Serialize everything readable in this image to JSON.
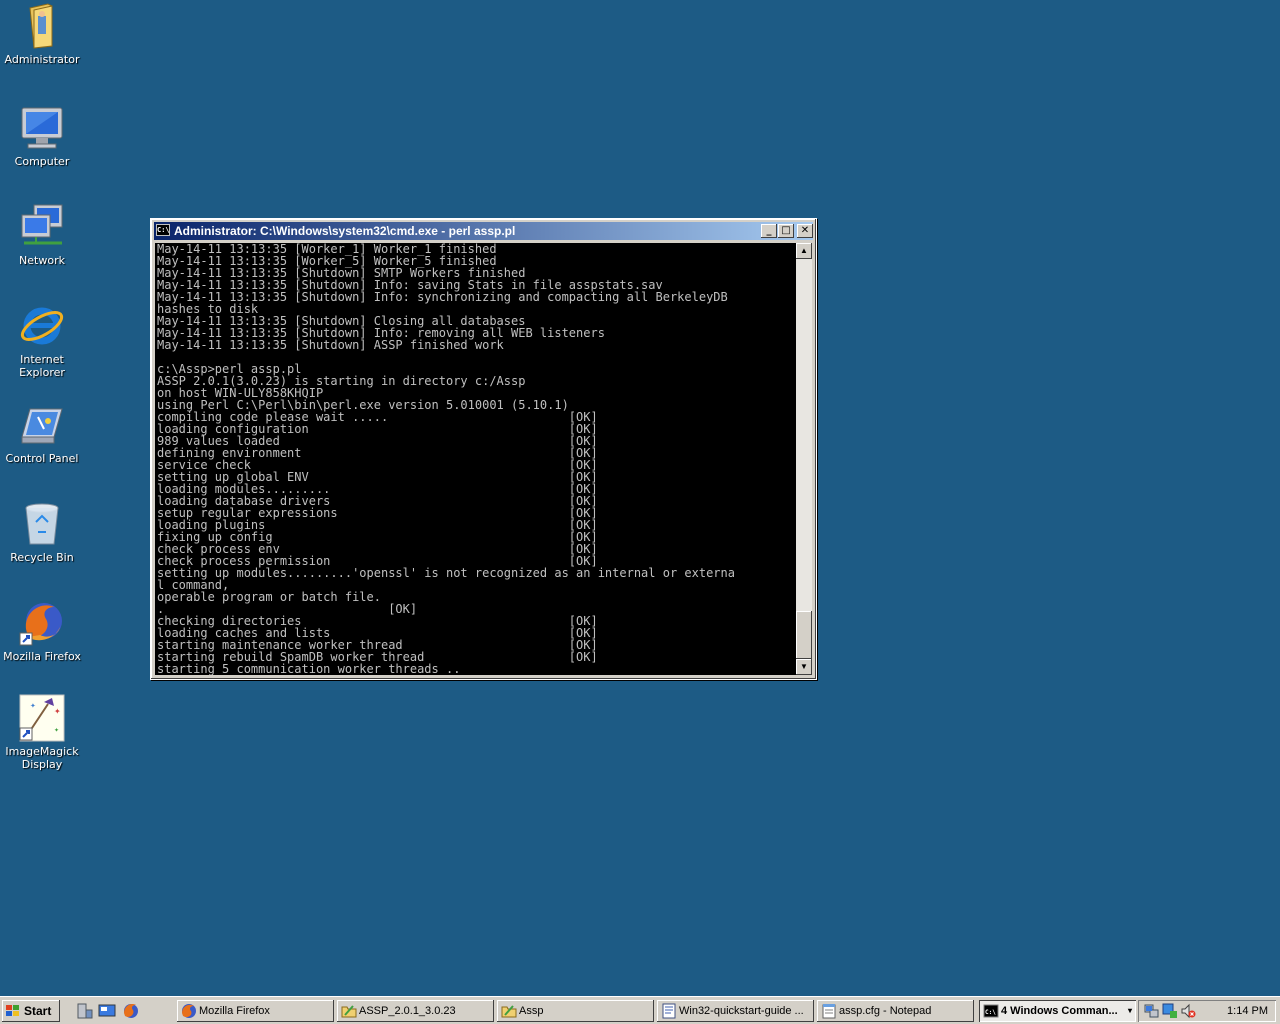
{
  "desktop": {
    "icons": [
      {
        "label": "Administrator",
        "icon": "folder-user-icon"
      },
      {
        "label": "Computer",
        "icon": "computer-icon"
      },
      {
        "label": "Network",
        "icon": "network-icon"
      },
      {
        "label": "Internet Explorer",
        "icon": "internet-explorer-icon"
      },
      {
        "label": "Control Panel",
        "icon": "control-panel-icon"
      },
      {
        "label": "Recycle Bin",
        "icon": "recycle-bin-icon"
      },
      {
        "label": "Mozilla Firefox",
        "icon": "firefox-icon"
      },
      {
        "label": "ImageMagick Display",
        "icon": "imagemagick-icon"
      }
    ],
    "background_color": "#1d5b85"
  },
  "console": {
    "title": "Administrator: C:\\Windows\\system32\\cmd.exe - perl  assp.pl",
    "icon_text": "C:\\",
    "minimize": "_",
    "maximize": "□",
    "close": "✕",
    "scroll_up": "▲",
    "scroll_down": "▼",
    "output": "May-14-11 13:13:35 [Worker_1] Worker_1 finished\nMay-14-11 13:13:35 [Worker_5] Worker_5 finished\nMay-14-11 13:13:35 [Shutdown] SMTP Workers finished\nMay-14-11 13:13:35 [Shutdown] Info: saving Stats in file asspstats.sav\nMay-14-11 13:13:35 [Shutdown] Info: synchronizing and compacting all BerkeleyDB\nhashes to disk\nMay-14-11 13:13:35 [Shutdown] Closing all databases\nMay-14-11 13:13:35 [Shutdown] Info: removing all WEB listeners\nMay-14-11 13:13:35 [Shutdown] ASSP finished work\n\nc:\\Assp>perl assp.pl\nASSP 2.0.1(3.0.23) is starting in directory c:/Assp\non host WIN-ULY858KHQIP\nusing Perl C:\\Perl\\bin\\perl.exe version 5.010001 (5.10.1)\ncompiling code please wait .....                         [OK]\nloading configuration                                    [OK]\n989 values loaded                                        [OK]\ndefining environment                                     [OK]\nservice check                                            [OK]\nsetting up global ENV                                    [OK]\nloading modules.........                                 [OK]\nloading database drivers                                 [OK]\nsetup regular expressions                                [OK]\nloading plugins                                          [OK]\nfixing up config                                         [OK]\ncheck process env                                        [OK]\ncheck process permission                                 [OK]\nsetting up modules.........'openssl' is not recognized as an internal or externa\nl command,\noperable program or batch file.\n.                               [OK]\nchecking directories                                     [OK]\nloading caches and lists                                 [OK]\nstarting maintenance worker thread                       [OK]\nstarting rebuild SpamDB worker thread                    [OK]\nstarting 5 communication worker threads .."
  },
  "taskbar": {
    "start_label": "Start",
    "quicklaunch": [
      "server-manager-icon",
      "show-desktop-icon",
      "firefox-icon"
    ],
    "tasks": [
      {
        "label": "Mozilla Firefox",
        "icon": "firefox-icon",
        "active": false
      },
      {
        "label": "ASSP_2.0.1_3.0.23",
        "icon": "folder-icon",
        "active": false
      },
      {
        "label": "Assp",
        "icon": "folder-icon",
        "active": false
      },
      {
        "label": "Win32-quickstart-guide ...",
        "icon": "wordpad-icon",
        "active": false
      },
      {
        "label": "assp.cfg - Notepad",
        "icon": "notepad-icon",
        "active": false
      },
      {
        "label": "4 Windows Comman...",
        "icon": "cmd-icon",
        "active": true
      }
    ],
    "tray_icons": [
      "network-tray-icon",
      "security-tray-icon",
      "volume-muted-icon"
    ],
    "clock": "1:14 PM"
  }
}
